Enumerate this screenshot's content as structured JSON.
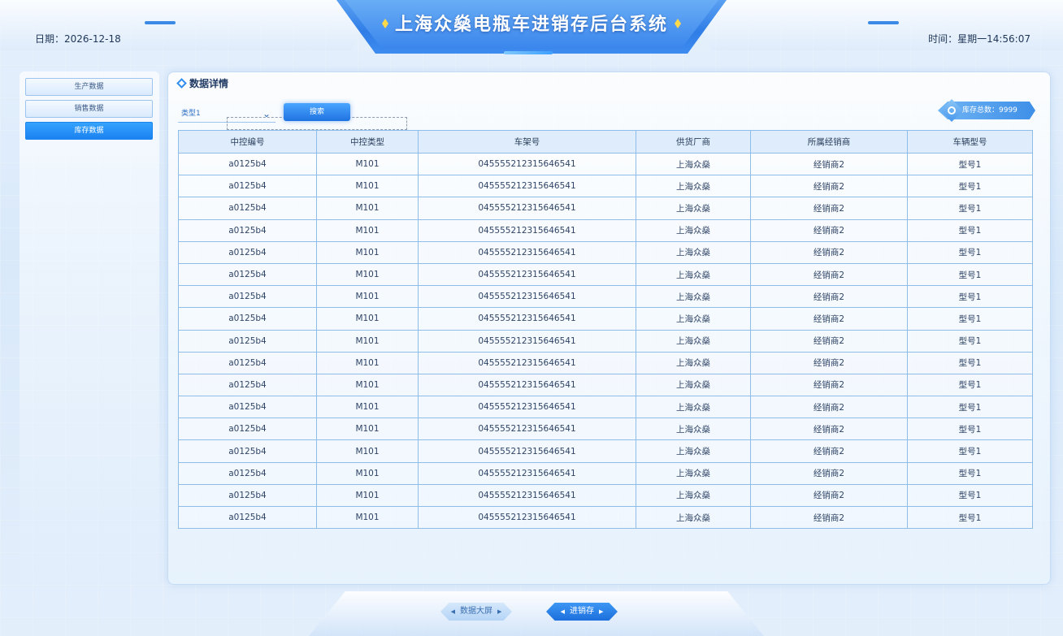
{
  "header": {
    "title": "上海众燊电瓶车进销存后台系统",
    "date": "日期：2026-12-18",
    "time": "时间：星期一14:56:07"
  },
  "sidebar": {
    "items": [
      {
        "label": "生产数据",
        "active": false
      },
      {
        "label": "销售数据",
        "active": false
      },
      {
        "label": "库存数据",
        "active": true
      }
    ]
  },
  "panel": {
    "title": "数据详情",
    "select_value": "类型1",
    "search_label": "搜索",
    "total_label": "库存总数：9999"
  },
  "table": {
    "headers": [
      "中控编号",
      "中控类型",
      "车架号",
      "供货厂商",
      "所属经销商",
      "车辆型号"
    ],
    "rows": [
      [
        "a0125b4",
        "M101",
        "045555212315646541",
        "上海众燊",
        "经销商2",
        "型号1"
      ],
      [
        "a0125b4",
        "M101",
        "045555212315646541",
        "上海众燊",
        "经销商2",
        "型号1"
      ],
      [
        "a0125b4",
        "M101",
        "045555212315646541",
        "上海众燊",
        "经销商2",
        "型号1"
      ],
      [
        "a0125b4",
        "M101",
        "045555212315646541",
        "上海众燊",
        "经销商2",
        "型号1"
      ],
      [
        "a0125b4",
        "M101",
        "045555212315646541",
        "上海众燊",
        "经销商2",
        "型号1"
      ],
      [
        "a0125b4",
        "M101",
        "045555212315646541",
        "上海众燊",
        "经销商2",
        "型号1"
      ],
      [
        "a0125b4",
        "M101",
        "045555212315646541",
        "上海众燊",
        "经销商2",
        "型号1"
      ],
      [
        "a0125b4",
        "M101",
        "045555212315646541",
        "上海众燊",
        "经销商2",
        "型号1"
      ],
      [
        "a0125b4",
        "M101",
        "045555212315646541",
        "上海众燊",
        "经销商2",
        "型号1"
      ],
      [
        "a0125b4",
        "M101",
        "045555212315646541",
        "上海众燊",
        "经销商2",
        "型号1"
      ],
      [
        "a0125b4",
        "M101",
        "045555212315646541",
        "上海众燊",
        "经销商2",
        "型号1"
      ],
      [
        "a0125b4",
        "M101",
        "045555212315646541",
        "上海众燊",
        "经销商2",
        "型号1"
      ],
      [
        "a0125b4",
        "M101",
        "045555212315646541",
        "上海众燊",
        "经销商2",
        "型号1"
      ],
      [
        "a0125b4",
        "M101",
        "045555212315646541",
        "上海众燊",
        "经销商2",
        "型号1"
      ],
      [
        "a0125b4",
        "M101",
        "045555212315646541",
        "上海众燊",
        "经销商2",
        "型号1"
      ],
      [
        "a0125b4",
        "M101",
        "045555212315646541",
        "上海众燊",
        "经销商2",
        "型号1"
      ],
      [
        "a0125b4",
        "M101",
        "045555212315646541",
        "上海众燊",
        "经销商2",
        "型号1"
      ]
    ]
  },
  "footer": {
    "buttons": [
      {
        "label": "数据大屏",
        "active": false
      },
      {
        "label": "进销存",
        "active": true
      }
    ]
  },
  "colors": {
    "accent": "#1b82f0",
    "title_gold": "#ffd94a",
    "border": "#8fbde9"
  }
}
